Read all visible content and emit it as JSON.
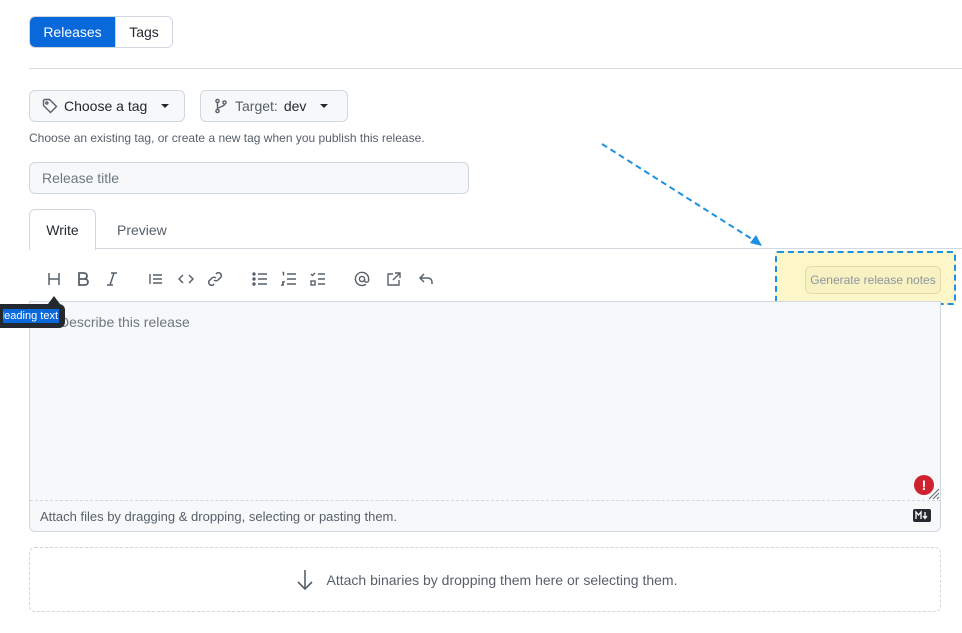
{
  "tabs": {
    "releases": "Releases",
    "tags": "Tags"
  },
  "tag_picker": {
    "label": "Choose a tag",
    "help": "Choose an existing tag, or create a new tag when you publish this release."
  },
  "target": {
    "label": "Target:",
    "value": "dev"
  },
  "release_title": {
    "placeholder": "Release title"
  },
  "editor_tabs": {
    "write": "Write",
    "preview": "Preview"
  },
  "toolbar": {
    "tooltip": "Heading text",
    "icons": [
      "heading-icon",
      "bold-icon",
      "italic-icon",
      "quote-icon",
      "code-icon",
      "link-icon",
      "unordered-list-icon",
      "ordered-list-icon",
      "task-list-icon",
      "mention-icon",
      "cross-reference-icon",
      "reply-icon"
    ]
  },
  "generate_notes": {
    "label": "Generate release notes"
  },
  "editor": {
    "placeholder": "Describe this release",
    "attach_hint": "Attach files by dragging & dropping, selecting or pasting them."
  },
  "binaries": {
    "label": "Attach binaries by dropping them here or selecting them."
  },
  "colors": {
    "accent": "#0969da",
    "highlight": "#fdf6c8",
    "highlight_border": "#1e90e0",
    "alert": "#cf222e"
  }
}
